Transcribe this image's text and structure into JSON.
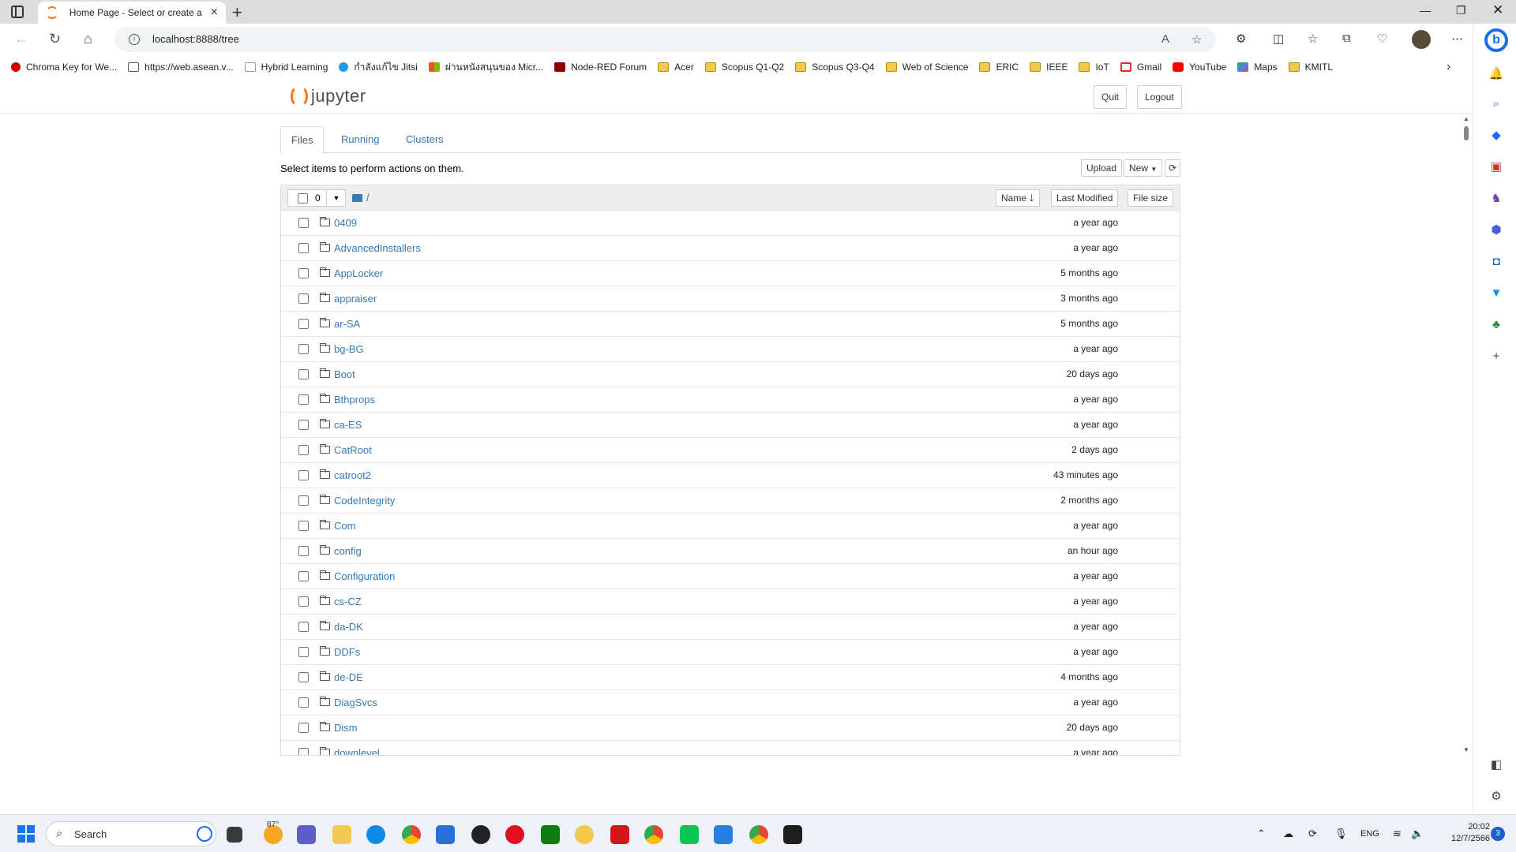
{
  "browser": {
    "tab_title": "Home Page - Select or create a n",
    "url": "localhost:8888/tree",
    "bookmarks": [
      {
        "label": "Chroma Key for We...",
        "kind": "site"
      },
      {
        "label": "https://web.asean.v...",
        "kind": "site"
      },
      {
        "label": "Hybrid Learning",
        "kind": "site"
      },
      {
        "label": "กำลังแก้ไข Jitsi",
        "kind": "site"
      },
      {
        "label": "ผ่านหนังสนุนของ Micr...",
        "kind": "site"
      },
      {
        "label": "Node-RED Forum",
        "kind": "site"
      },
      {
        "label": "Acer",
        "kind": "folder"
      },
      {
        "label": "Scopus Q1-Q2",
        "kind": "folder"
      },
      {
        "label": "Scopus Q3-Q4",
        "kind": "folder"
      },
      {
        "label": "Web of Science",
        "kind": "folder"
      },
      {
        "label": "ERIC",
        "kind": "folder"
      },
      {
        "label": "IEEE",
        "kind": "folder"
      },
      {
        "label": "IoT",
        "kind": "folder"
      },
      {
        "label": "Gmail",
        "kind": "site"
      },
      {
        "label": "YouTube",
        "kind": "site"
      },
      {
        "label": "Maps",
        "kind": "site"
      },
      {
        "label": "KMITL",
        "kind": "folder"
      }
    ]
  },
  "jupyter": {
    "logo_text": "jupyter",
    "quit_label": "Quit",
    "logout_label": "Logout",
    "tabs": [
      {
        "label": "Files",
        "active": true
      },
      {
        "label": "Running",
        "active": false
      },
      {
        "label": "Clusters",
        "active": false
      }
    ],
    "hint": "Select items to perform actions on them.",
    "upload_label": "Upload",
    "new_label": "New",
    "selected_count": "0",
    "breadcrumb": "/",
    "sort": {
      "name_label": "Name",
      "modified_label": "Last Modified",
      "size_label": "File size"
    },
    "items": [
      {
        "name": "0409",
        "modified": "a year ago"
      },
      {
        "name": "AdvancedInstallers",
        "modified": "a year ago"
      },
      {
        "name": "AppLocker",
        "modified": "5 months ago"
      },
      {
        "name": "appraiser",
        "modified": "3 months ago"
      },
      {
        "name": "ar-SA",
        "modified": "5 months ago"
      },
      {
        "name": "bg-BG",
        "modified": "a year ago"
      },
      {
        "name": "Boot",
        "modified": "20 days ago"
      },
      {
        "name": "Bthprops",
        "modified": "a year ago"
      },
      {
        "name": "ca-ES",
        "modified": "a year ago"
      },
      {
        "name": "CatRoot",
        "modified": "2 days ago"
      },
      {
        "name": "catroot2",
        "modified": "43 minutes ago"
      },
      {
        "name": "CodeIntegrity",
        "modified": "2 months ago"
      },
      {
        "name": "Com",
        "modified": "a year ago"
      },
      {
        "name": "config",
        "modified": "an hour ago"
      },
      {
        "name": "Configuration",
        "modified": "a year ago"
      },
      {
        "name": "cs-CZ",
        "modified": "a year ago"
      },
      {
        "name": "da-DK",
        "modified": "a year ago"
      },
      {
        "name": "DDFs",
        "modified": "a year ago"
      },
      {
        "name": "de-DE",
        "modified": "4 months ago"
      },
      {
        "name": "DiagSvcs",
        "modified": "a year ago"
      },
      {
        "name": "Dism",
        "modified": "20 days ago"
      },
      {
        "name": "downlevel",
        "modified": "a year ago"
      }
    ]
  },
  "taskbar": {
    "search_placeholder": "Search",
    "weather": "87°",
    "language": "ENG",
    "time": "20:02",
    "date": "12/7/2566",
    "notification_count": "3"
  },
  "colors": {
    "jupyter_orange": "#f37626",
    "link_blue": "#337ab7",
    "edge_blue": "#1b6ef3"
  }
}
